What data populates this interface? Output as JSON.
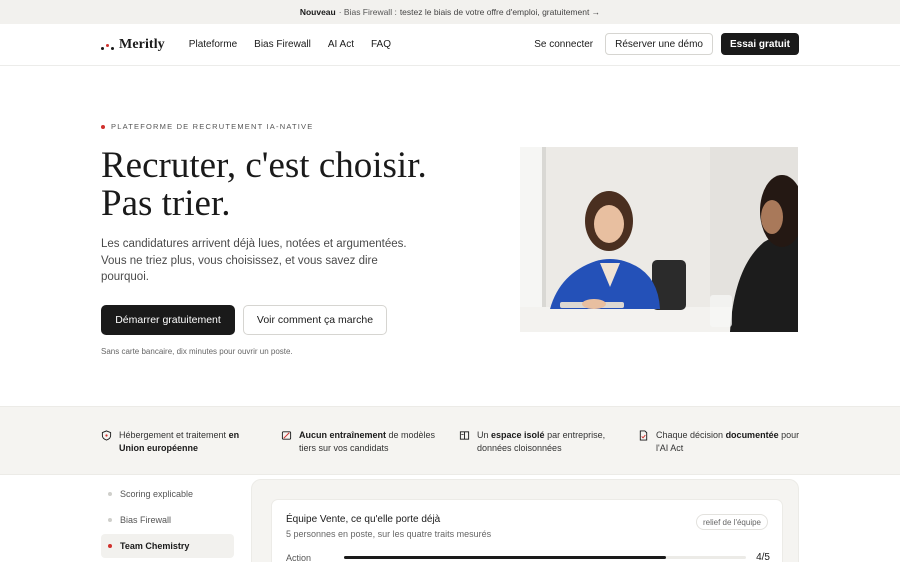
{
  "announcement": {
    "prefix": "Nouveau",
    "separator": " · Bias Firewall : ",
    "link": "testez le biais de votre offre d'emploi, gratuitement →"
  },
  "nav": {
    "brand": "Meritly",
    "links": [
      "Plateforme",
      "Bias Firewall",
      "AI Act",
      "FAQ"
    ],
    "login": "Se connecter",
    "demo": "Réserver une démo",
    "trial": "Essai gratuit"
  },
  "hero": {
    "eyebrow": "PLATEFORME DE RECRUTEMENT IA-NATIVE",
    "headline_line1": "Recruter, c'est choisir.",
    "headline_line2": "Pas trier.",
    "subtext": "Les candidatures arrivent déjà lues, notées et argumentées. Vous ne triez plus, vous choisissez, et vous savez dire pourquoi.",
    "cta_primary": "Démarrer gratuitement",
    "cta_secondary": "Voir comment ça marche",
    "fineprint": "Sans carte bancaire, dix minutes pour ouvrir un poste."
  },
  "trust": [
    {
      "icon": "shield-icon",
      "pre": "Hébergement et traitement ",
      "bold": "en Union européenne",
      "post": ""
    },
    {
      "icon": "no-training-icon",
      "pre": "",
      "bold": "Aucun entraînement",
      "post": " de modèles tiers sur vos candidats"
    },
    {
      "icon": "isolation-icon",
      "pre": "Un ",
      "bold": "espace isolé",
      "post": " par entreprise, données cloisonnées"
    },
    {
      "icon": "document-icon",
      "pre": "Chaque décision ",
      "bold": "documentée",
      "post": " pour l'AI Act"
    }
  ],
  "features": [
    "Scoring explicable",
    "Bias Firewall",
    "Team Chemistry"
  ],
  "features_active": 2,
  "card": {
    "title": "Équipe Vente, ce qu'elle porte déjà",
    "subtitle": "5 personnes en poste, sur les quatre traits mesurés",
    "badge": "relief de l'équipe",
    "metric_label": "Action",
    "metric_value": "4/5",
    "metric_fraction": 0.8
  }
}
